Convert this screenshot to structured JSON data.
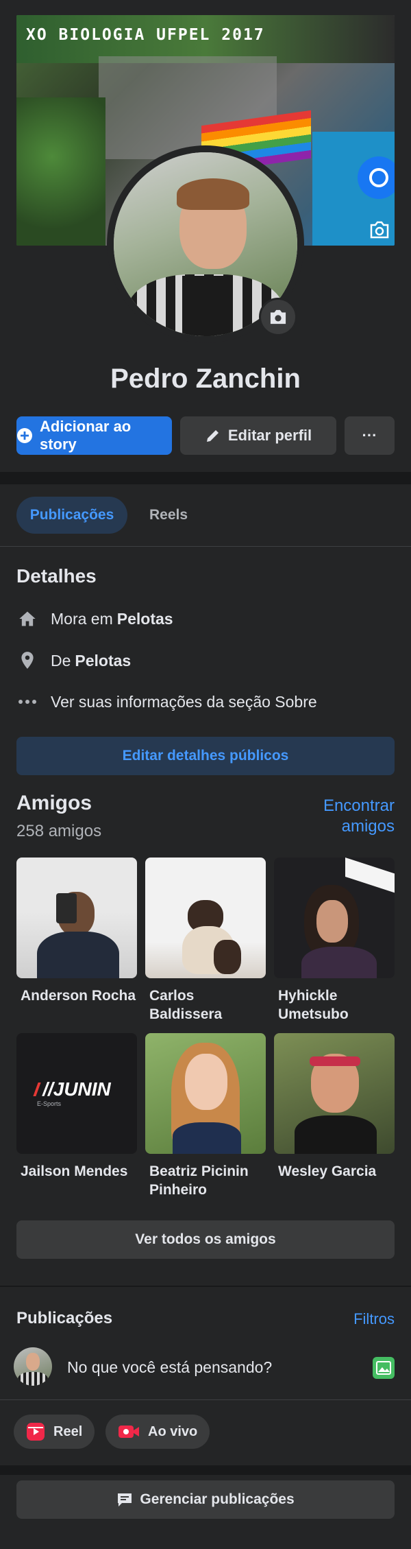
{
  "profile": {
    "cover_title": "XO BIOLOGIA UFPEL 2017",
    "name": "Pedro Zanchin",
    "add_story_label": "Adicionar ao story",
    "edit_profile_label": "Editar perfil",
    "more_label": "···"
  },
  "tabs": [
    {
      "label": "Publicações",
      "active": true
    },
    {
      "label": "Reels",
      "active": false
    }
  ],
  "details": {
    "title": "Detalhes",
    "lives_prefix": "Mora em",
    "lives_city": "Pelotas",
    "from_prefix": "De",
    "from_city": "Pelotas",
    "about_link": "Ver suas informações da seção Sobre",
    "edit_public_label": "Editar detalhes públicos"
  },
  "friends": {
    "title": "Amigos",
    "count": "258 amigos",
    "find_label": "Encontrar amigos",
    "see_all_label": "Ver todos os amigos",
    "items": [
      {
        "name": "Anderson Rocha"
      },
      {
        "name": "Carlos Baldissera"
      },
      {
        "name": "Hyhickle Umetsubo"
      },
      {
        "name": "Jailson Mendes",
        "photo_text": "//JUNIN",
        "photo_subtext": "E-Sports"
      },
      {
        "name": "Beatriz Picinin Pinheiro"
      },
      {
        "name": "Wesley Garcia"
      }
    ]
  },
  "posts": {
    "title": "Publicações",
    "filters_label": "Filtros",
    "composer_placeholder": "No que você está pensando?",
    "reel_label": "Reel",
    "live_label": "Ao vivo",
    "manage_label": "Gerenciar publicações"
  },
  "colors": {
    "background": "#18191a",
    "card": "#242526",
    "accent": "#2374e1",
    "link": "#4599ff"
  }
}
